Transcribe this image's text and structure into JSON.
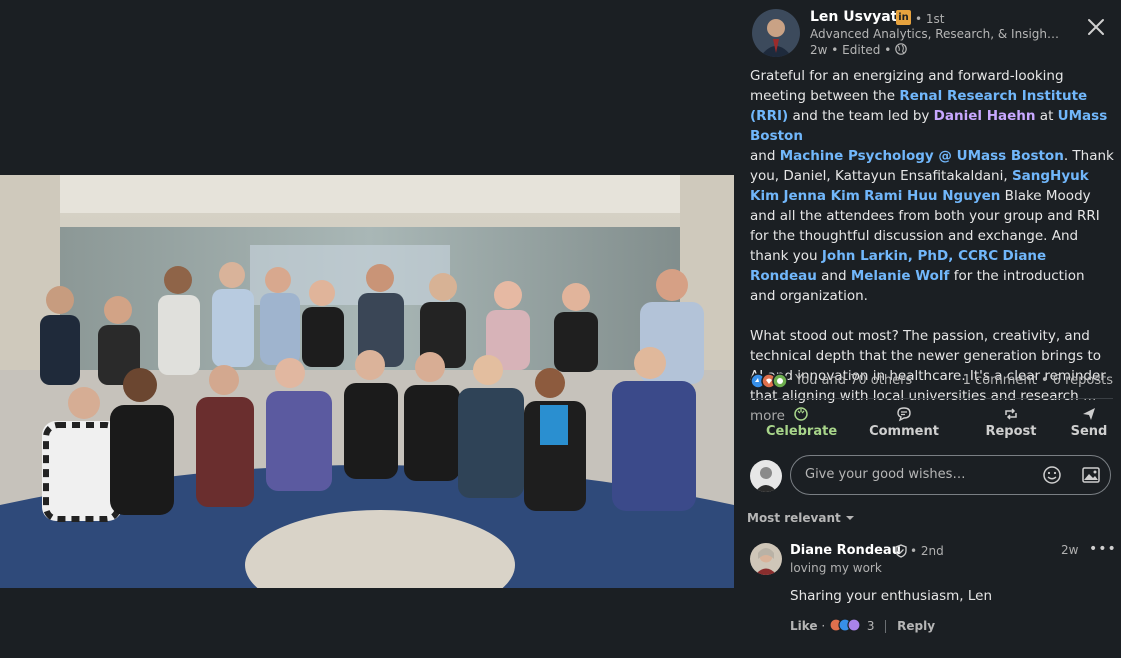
{
  "post": {
    "author": {
      "name": "Len Usvyat",
      "badge": "in",
      "degree": "• 1st",
      "headline": "Advanced Analytics, Research, & Insights | H...",
      "meta": "2w • Edited •"
    },
    "text": {
      "p1_s1": "Grateful for an energizing and forward-looking meeting between the ",
      "m_rri": "Renal Research Institute (RRI)",
      "p1_s2": "  and the team led by ",
      "m_haehn": "Daniel Haehn",
      "p1_s3": " at ",
      "m_umass": "UMass Boston",
      "p1_s4": " and ",
      "m_machine": "Machine Psychology @ UMass Boston",
      "p1_s5": ". Thank you, Daniel, Kattayun Ensafitakaldani, ",
      "m_kim": "SangHyuk Kim",
      "p1_s6": " ",
      "m_jenna": "Jenna Kim",
      "p1_s7": " ",
      "m_rami": "Rami Huu Nguyen",
      "p1_s8": " Blake Moody and all the attendees from both your group and RRI for the thoughtful discussion and exchange. And thank you ",
      "m_larkin": "John Larkin, PhD, CCRC",
      "p1_s9": " ",
      "m_rondeau": "Diane Rondeau",
      "p1_s10": " and ",
      "m_wolf": "Melanie Wolf",
      "p1_s11": "  for the introduction and organization.",
      "p2": "What stood out most? The passion, creativity, and technical depth that the newer generation brings to AI and innovation in healthcare. It's a clear reminder that aligning with local universities and research ",
      "more": "…more"
    },
    "reactions": {
      "summary": "You and 70 others",
      "counts": "1 comment • 6 reposts"
    },
    "actions": [
      "Celebrate",
      "Comment",
      "Repost",
      "Send"
    ],
    "comment_box": {
      "placeholder": "Give your good wishes…"
    },
    "sort_label": "Most relevant",
    "comment": {
      "author": "Diane Rondeau",
      "degree": "• 2nd",
      "headline": "loving my work",
      "time": "2w",
      "menu": "•••",
      "text": "Sharing your enthusiasm, Len",
      "like": "Like",
      "reaction_count": "3",
      "reply": "Reply"
    }
  },
  "colors": {
    "background": "#1b1f23",
    "link": "#71b7fb",
    "mention_purple": "#c8a8ff",
    "celebrate": "#a8d58a",
    "linkedin_badge": "#e7a33e"
  },
  "icons": [
    "close-icon",
    "globe-icon",
    "celebrate-icon",
    "comment-icon",
    "repost-icon",
    "send-icon",
    "emoji-icon",
    "image-icon",
    "chevron-down-icon",
    "verified-icon"
  ]
}
